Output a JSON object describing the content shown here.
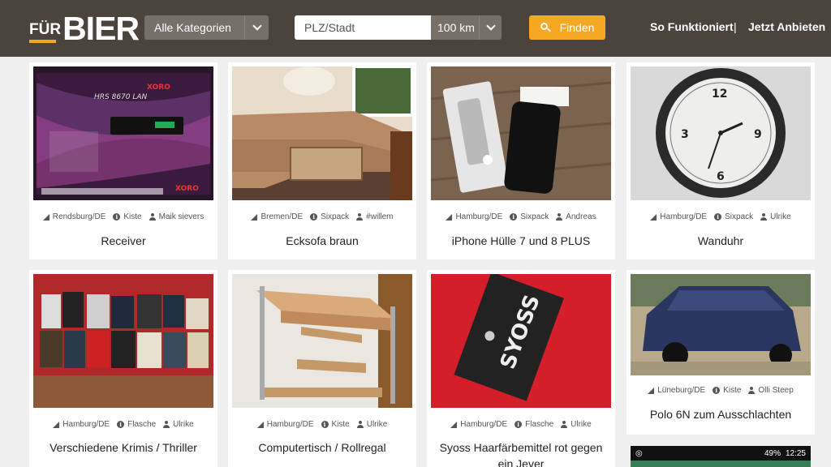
{
  "header": {
    "logo_small": "FÜR",
    "logo_big": "BIER",
    "category_select": "Alle Kategorien",
    "location_placeholder": "PLZ/Stadt",
    "radius_select": "100 km",
    "find_button": "Finden",
    "nav_how": "So Funktioniert",
    "nav_separator": "|",
    "nav_offer": "Jetzt Anbieten"
  },
  "listings": [
    {
      "location": "Rendsburg/DE",
      "type": "Kiste",
      "user": "Maik sievers",
      "title": "Receiver"
    },
    {
      "location": "Bremen/DE",
      "type": "Sixpack",
      "user": "#willem",
      "title": "Ecksofa braun"
    },
    {
      "location": "Hamburg/DE",
      "type": "Sixpack",
      "user": "Andreas",
      "title": "iPhone Hülle 7 und 8 PLUS"
    },
    {
      "location": "Hamburg/DE",
      "type": "Sixpack",
      "user": "Ulrike",
      "title": "Wanduhr"
    },
    {
      "location": "Hamburg/DE",
      "type": "Flasche",
      "user": "Ulrike",
      "title": "Verschiedene Krimis / Thriller"
    },
    {
      "location": "Hamburg/DE",
      "type": "Kiste",
      "user": "Ulrike",
      "title": "Computertisch / Rollregal"
    },
    {
      "location": "Hamburg/DE",
      "type": "Flasche",
      "user": "Ulrike",
      "title": "Syoss Haarfärbemittel rot gegen ein Jever"
    },
    {
      "location": "Lüneburg/DE",
      "type": "Kiste",
      "user": "Olli Steep",
      "title": "Polo 6N zum Ausschlachten"
    }
  ],
  "photo_text": {
    "receiver_brand": "XORO",
    "receiver_model": "HRS 8670 LAN",
    "syoss_brand": "SYOSS"
  },
  "phone_status": {
    "battery": "49%",
    "time": "12:25"
  },
  "colors": {
    "header_bg": "#4b443d",
    "select_bg": "#777069",
    "accent": "#f7a823",
    "page_bg": "#efefef"
  }
}
